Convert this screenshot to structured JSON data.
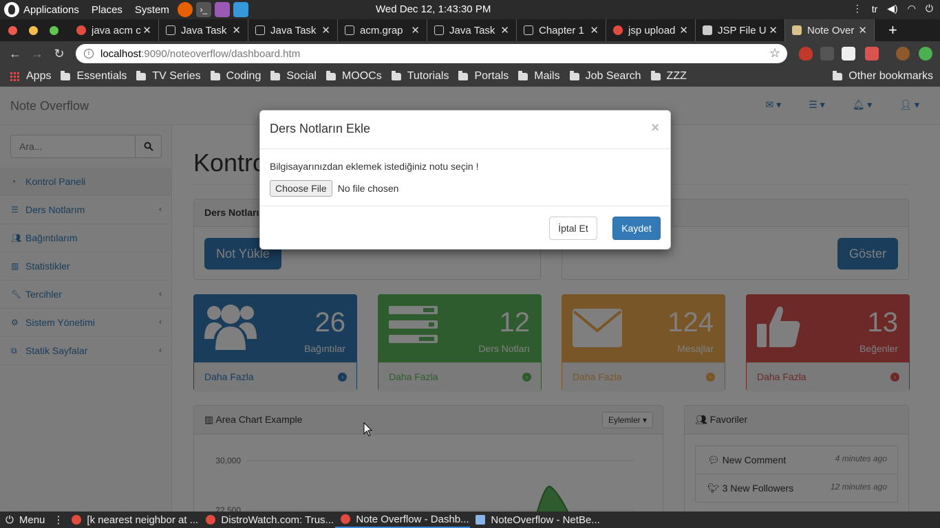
{
  "os_panel": {
    "menus": [
      "Applications",
      "Places",
      "System"
    ],
    "clock": "Wed Dec 12,  1:43:30 PM",
    "keyboard_layout": "tr",
    "tray_icons": [
      "more-icon",
      "volume-icon",
      "wifi-icon",
      "power-icon"
    ]
  },
  "browser": {
    "tabs": [
      {
        "label": "java acm c",
        "icon": "google-icon"
      },
      {
        "label": "Java Task",
        "icon": "page-icon"
      },
      {
        "label": "Java Task",
        "icon": "page-icon"
      },
      {
        "label": "acm.grap",
        "icon": "page-icon"
      },
      {
        "label": "Java Task",
        "icon": "page-icon"
      },
      {
        "label": "Chapter 1",
        "icon": "page-icon"
      },
      {
        "label": "jsp upload",
        "icon": "google-icon"
      },
      {
        "label": "JSP File U",
        "icon": "site-icon"
      },
      {
        "label": "Note Over",
        "icon": "site-icon",
        "active": true
      }
    ],
    "url_host": "localhost",
    "url_path": ":9090/noteoverflow/dashboard.htm",
    "bookmarks": [
      "Apps",
      "Essentials",
      "TV Series",
      "Coding",
      "Social",
      "MOOCs",
      "Tutorials",
      "Portals",
      "Mails",
      "Job Search",
      "ZZZ"
    ],
    "other_bookmarks": "Other bookmarks"
  },
  "app": {
    "brand": "Note Overflow",
    "search_placeholder": "Ara...",
    "sidebar": [
      {
        "label": "Kontrol Paneli",
        "icon": "dashboard-icon",
        "active": true
      },
      {
        "label": "Ders Notlarım",
        "icon": "list-icon",
        "arrow": true
      },
      {
        "label": "Bağıntılarım",
        "icon": "users-icon"
      },
      {
        "label": "Statistikler",
        "icon": "bar-chart-icon"
      },
      {
        "label": "Tercihler",
        "icon": "wrench-icon",
        "arrow": true
      },
      {
        "label": "Sistem Yönetimi",
        "icon": "gear-icon",
        "arrow": true
      },
      {
        "label": "Statik Sayfalar",
        "icon": "copy-icon",
        "arrow": true
      }
    ],
    "page_title": "Kontrol Paneli",
    "notes_panel_title": "Ders Notları",
    "upload_button": "Not Yükle",
    "show_button": "Göster",
    "stats": [
      {
        "value": "26",
        "caption": "Bağıntılar",
        "more": "Daha Fazla",
        "color": "#337ab7",
        "icon": "users-icon"
      },
      {
        "value": "12",
        "caption": "Ders Notları",
        "more": "Daha Fazla",
        "color": "#5cb85c",
        "icon": "tasks-icon"
      },
      {
        "value": "124",
        "caption": "Mesajlar",
        "more": "Daha Fazla",
        "color": "#f0ad4e",
        "icon": "envelope-icon"
      },
      {
        "value": "13",
        "caption": "Beğenler",
        "more": "Daha Fazla",
        "color": "#d9534f",
        "icon": "thumbs-up-icon"
      }
    ],
    "chart": {
      "title": "Area Chart Example",
      "actions_button": "Eylemler",
      "y_ticks": [
        "30,000",
        "22,500"
      ]
    },
    "favorites": {
      "title": "Favoriler",
      "items": [
        {
          "label": "New Comment",
          "time": "4 minutes ago",
          "icon": "comment-icon"
        },
        {
          "label": "3 New Followers",
          "time": "12 minutes ago",
          "icon": "twitter-icon"
        }
      ]
    }
  },
  "modal": {
    "title": "Ders Notların Ekle",
    "close": "×",
    "prompt": "Bilgisayarınızdan eklemek istediğiniz notu seçin !",
    "file_button": "Choose File",
    "file_status": "No file chosen",
    "cancel": "İptal Et",
    "save": "Kaydet"
  },
  "taskbar": {
    "menu": "Menu",
    "tasks": [
      {
        "label": "[k nearest neighbor at ..."
      },
      {
        "label": "DistroWatch.com: Trus..."
      },
      {
        "label": "Note Overflow - Dashb...",
        "active": true
      },
      {
        "label": "NoteOverflow - NetBe..."
      }
    ]
  },
  "colors": {
    "primary": "#337ab7",
    "success": "#5cb85c",
    "warning": "#f0ad4e",
    "danger": "#d9534f"
  }
}
